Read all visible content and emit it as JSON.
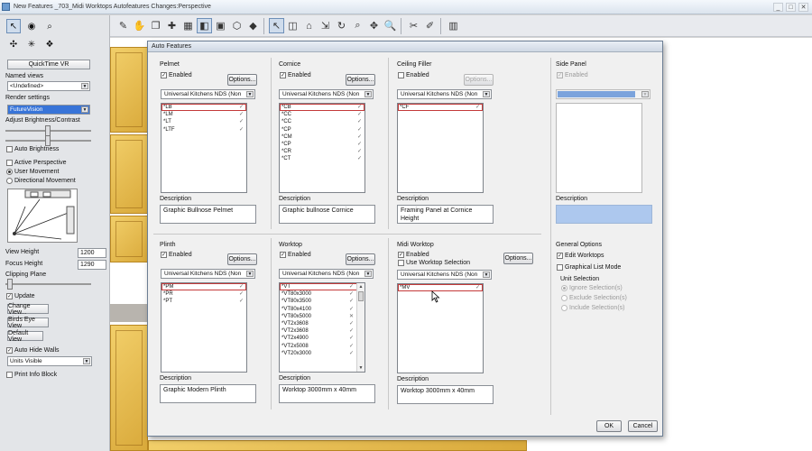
{
  "window": {
    "title": "New Features _703_Midi Worktops Autofeatures Changes:Perspective",
    "controls": [
      "_",
      "□",
      "✕"
    ]
  },
  "left_panel": {
    "quicktime_label": "QuickTime VR",
    "named_views_label": "Named views",
    "named_views_value": "<Undefined>",
    "render_settings_label": "Render settings",
    "render_settings_value": "FutureVision",
    "brightness_label": "Adjust Brightness/Contrast",
    "auto_brightness_label": "Auto Brightness",
    "active_perspective_label": "Active Perspective",
    "user_movement_label": "User Movement",
    "directional_movement_label": "Directional Movement",
    "view_height_label": "View Height",
    "view_height_value": "1200",
    "focus_height_label": "Focus Height",
    "focus_height_value": "1290",
    "clipping_plane_label": "Clipping Plane",
    "update_label": "Update",
    "change_view_label": "Change View...",
    "birds_eye_label": "Birds Eye View",
    "default_view_label": "Default View",
    "auto_hide_walls_label": "Auto Hide Walls",
    "units_visible_value": "Units Visible",
    "print_info_label": "Print Info Block"
  },
  "dialog": {
    "title": "Auto Features",
    "enabled_label": "Enabled",
    "options_label": "Options...",
    "description_label": "Description",
    "catalogue": "Universal Kitchens NDS (Non",
    "groups": {
      "pelmet": {
        "title": "Pelmet",
        "items": [
          "*LB",
          "*LM",
          "*LT",
          "*LTF"
        ],
        "description": "Graphic Bullnose Pelmet"
      },
      "cornice": {
        "title": "Cornice",
        "items": [
          "*CB",
          "*CC",
          "*CC",
          "*CP",
          "*CM",
          "*CP",
          "*CR",
          "*CT"
        ],
        "description": "Graphic bullnose Cornice"
      },
      "ceiling_filler": {
        "title": "Ceiling Filler",
        "items": [
          "*CF"
        ],
        "description": "Framing Panel at Cornice Height"
      },
      "side_panel": {
        "title": "Side Panel",
        "items": []
      },
      "plinth": {
        "title": "Plinth",
        "items": [
          "*PM",
          "*PR",
          "*PT"
        ],
        "description": "Graphic Modern Plinth"
      },
      "worktop": {
        "title": "Worktop",
        "items": [
          "*VT",
          "*VT80x3000",
          "*VT80x3500",
          "*VT80x4100",
          "*VT80x5000",
          "*VT2x3608",
          "*VT2x3608",
          "*VT2x4900",
          "*VT2x5008",
          "*VT20x3000"
        ],
        "description": "Worktop 3000mm x 40mm"
      },
      "midi_worktop": {
        "title": "Midi Worktop",
        "use_selection_label": "Use Worktop Selection",
        "items": [
          "*MV"
        ],
        "description": "Worktop 3000mm x 40mm"
      }
    },
    "general": {
      "title": "General Options",
      "edit_worktops_label": "Edit Worktops",
      "graphical_list_label": "Graphical List Mode",
      "unit_selection_label": "Unit Selection",
      "ignore_label": "Ignore Selection(s)",
      "exclude_label": "Exclude Selection(s)",
      "include_label": "Include Selection(s)"
    },
    "ok_label": "OK",
    "cancel_label": "Cancel"
  }
}
